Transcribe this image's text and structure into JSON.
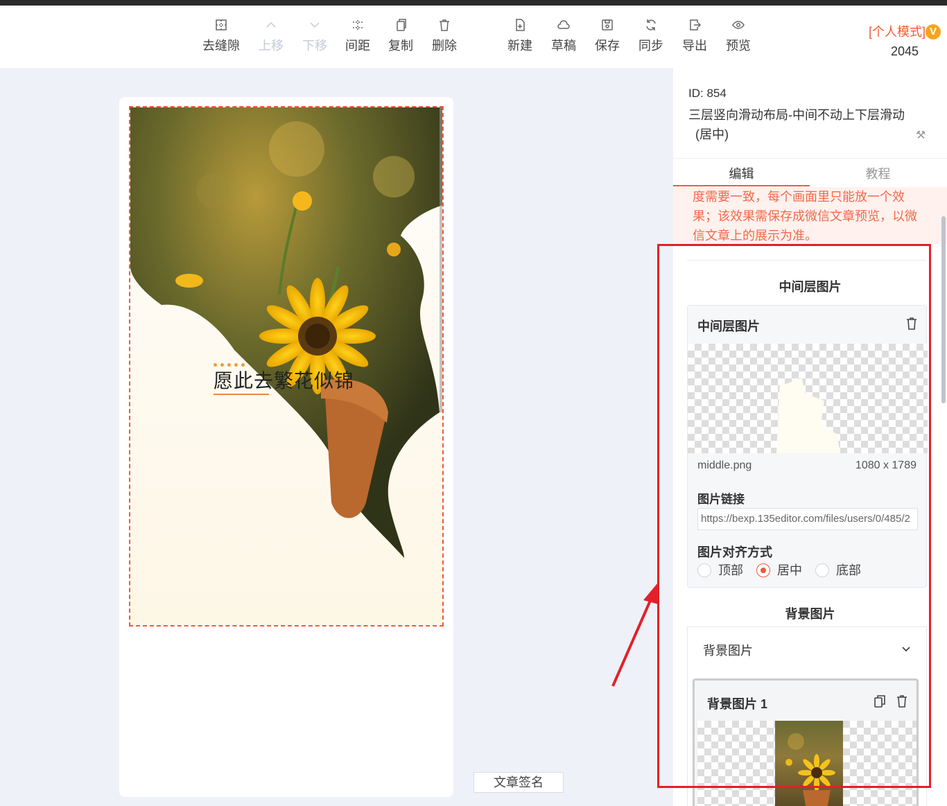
{
  "toolbar": {
    "left_tools": [
      {
        "label": "去缝隙",
        "icon": "gap-icon",
        "disabled": false
      },
      {
        "label": "上移",
        "icon": "chevron-up-icon",
        "disabled": true
      },
      {
        "label": "下移",
        "icon": "chevron-down-icon",
        "disabled": true
      },
      {
        "label": "间距",
        "icon": "spacing-icon",
        "disabled": false
      },
      {
        "label": "复制",
        "icon": "copy-icon",
        "disabled": false
      },
      {
        "label": "删除",
        "icon": "trash-icon",
        "disabled": false
      }
    ],
    "right_tools": [
      {
        "label": "新建",
        "icon": "new-file-icon"
      },
      {
        "label": "草稿",
        "icon": "cloud-icon"
      },
      {
        "label": "保存",
        "icon": "save-icon"
      },
      {
        "label": "同步",
        "icon": "sync-icon"
      },
      {
        "label": "导出",
        "icon": "export-icon"
      },
      {
        "label": "预览",
        "icon": "eye-icon"
      }
    ],
    "mode_label": "[个人模式]",
    "vip_badge": "V",
    "mode_number": "2045"
  },
  "canvas": {
    "headline": "愿此去繁花似锦",
    "signature_label": "文章签名"
  },
  "panel": {
    "id_text": "ID: 854",
    "title": "三层竖向滑动布局-中间不动上下层滑动",
    "title_sub": "(居中)",
    "tabs": [
      "编辑",
      "教程"
    ],
    "notice": "度需要一致，每个画面里只能放一个效果；该效果需保存成微信文章预览，以微信文章上的展示为准。",
    "middle_section_title": "中间层图片",
    "middle_card": {
      "title": "中间层图片",
      "file_name": "middle.png",
      "file_size": "1080 x 1789",
      "link_label": "图片链接",
      "link_value": "https://bexp.135editor.com/files/users/0/485/2",
      "align_label": "图片对齐方式",
      "align_options": [
        "顶部",
        "居中",
        "底部"
      ],
      "align_selected": "居中"
    },
    "bg_section_title": "背景图片",
    "bg_card": {
      "header": "背景图片",
      "item_title": "背景图片 1"
    }
  },
  "colors": {
    "accent": "#f05a3c",
    "highlight_box": "#e3202a",
    "vip": "#f6a51b"
  }
}
